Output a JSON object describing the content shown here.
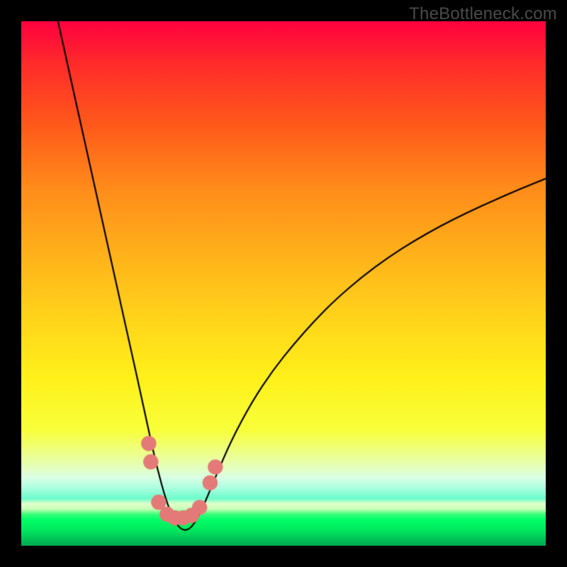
{
  "watermark": "TheBottleneck.com",
  "chart_data": {
    "type": "line",
    "title": "",
    "xlabel": "",
    "ylabel": "",
    "xlim": [
      0,
      100
    ],
    "ylim": [
      0,
      100
    ],
    "grid": false,
    "legend": false,
    "gradient_stops": [
      {
        "pct": 0,
        "color": "#ff0040"
      },
      {
        "pct": 8,
        "color": "#ff2a2a"
      },
      {
        "pct": 20,
        "color": "#ff5a1a"
      },
      {
        "pct": 32,
        "color": "#ff8c1a"
      },
      {
        "pct": 44,
        "color": "#ffb01a"
      },
      {
        "pct": 56,
        "color": "#ffd21a"
      },
      {
        "pct": 68,
        "color": "#fff01a"
      },
      {
        "pct": 78,
        "color": "#f8ff3a"
      },
      {
        "pct": 84,
        "color": "#e8ffa8"
      },
      {
        "pct": 87,
        "color": "#daffe4"
      },
      {
        "pct": 89,
        "color": "#aaffe0"
      },
      {
        "pct": 91,
        "color": "#6cfccb"
      },
      {
        "pct": 92,
        "color": "#e0ffc8"
      },
      {
        "pct": 93,
        "color": "#c8ffb8"
      },
      {
        "pct": 94,
        "color": "#3aff7a"
      },
      {
        "pct": 95,
        "color": "#00ff66"
      },
      {
        "pct": 97,
        "color": "#00e85e"
      },
      {
        "pct": 98.5,
        "color": "#00c858"
      },
      {
        "pct": 100,
        "color": "#00a850"
      }
    ],
    "curve": {
      "description": "V-shaped bottleneck curve, minimum near x≈30; left branch steep to y=100 at x≈7, right branch rises to y≈70 at x=100",
      "x": [
        7.0,
        9.0,
        11.0,
        13.0,
        15.0,
        17.0,
        19.0,
        21.0,
        23.0,
        24.5,
        26.0,
        27.5,
        29.0,
        30.5,
        32.0,
        33.5,
        35.0,
        37.0,
        40.0,
        44.0,
        48.0,
        52.0,
        56.0,
        60.0,
        65.0,
        70.0,
        75.0,
        80.0,
        85.0,
        90.0,
        95.0,
        100.0
      ],
      "y": [
        100.0,
        91.0,
        82.0,
        73.0,
        64.0,
        55.0,
        46.0,
        37.0,
        28.0,
        21.0,
        14.5,
        9.0,
        5.0,
        3.0,
        3.0,
        5.0,
        8.2,
        13.0,
        20.0,
        27.5,
        33.5,
        38.5,
        43.0,
        47.0,
        51.3,
        55.0,
        58.2,
        61.0,
        63.5,
        65.8,
        68.0,
        70.0
      ]
    },
    "markers": {
      "color": "#e47a78",
      "radius_pct": 1.45,
      "points": [
        {
          "x": 24.3,
          "y": 19.5
        },
        {
          "x": 24.7,
          "y": 16.0
        },
        {
          "x": 26.2,
          "y": 8.3
        },
        {
          "x": 27.8,
          "y": 6.0
        },
        {
          "x": 29.3,
          "y": 5.3
        },
        {
          "x": 30.9,
          "y": 5.3
        },
        {
          "x": 32.5,
          "y": 5.8
        },
        {
          "x": 34.0,
          "y": 7.3
        },
        {
          "x": 36.0,
          "y": 12.0
        },
        {
          "x": 37.0,
          "y": 15.0
        }
      ]
    }
  }
}
